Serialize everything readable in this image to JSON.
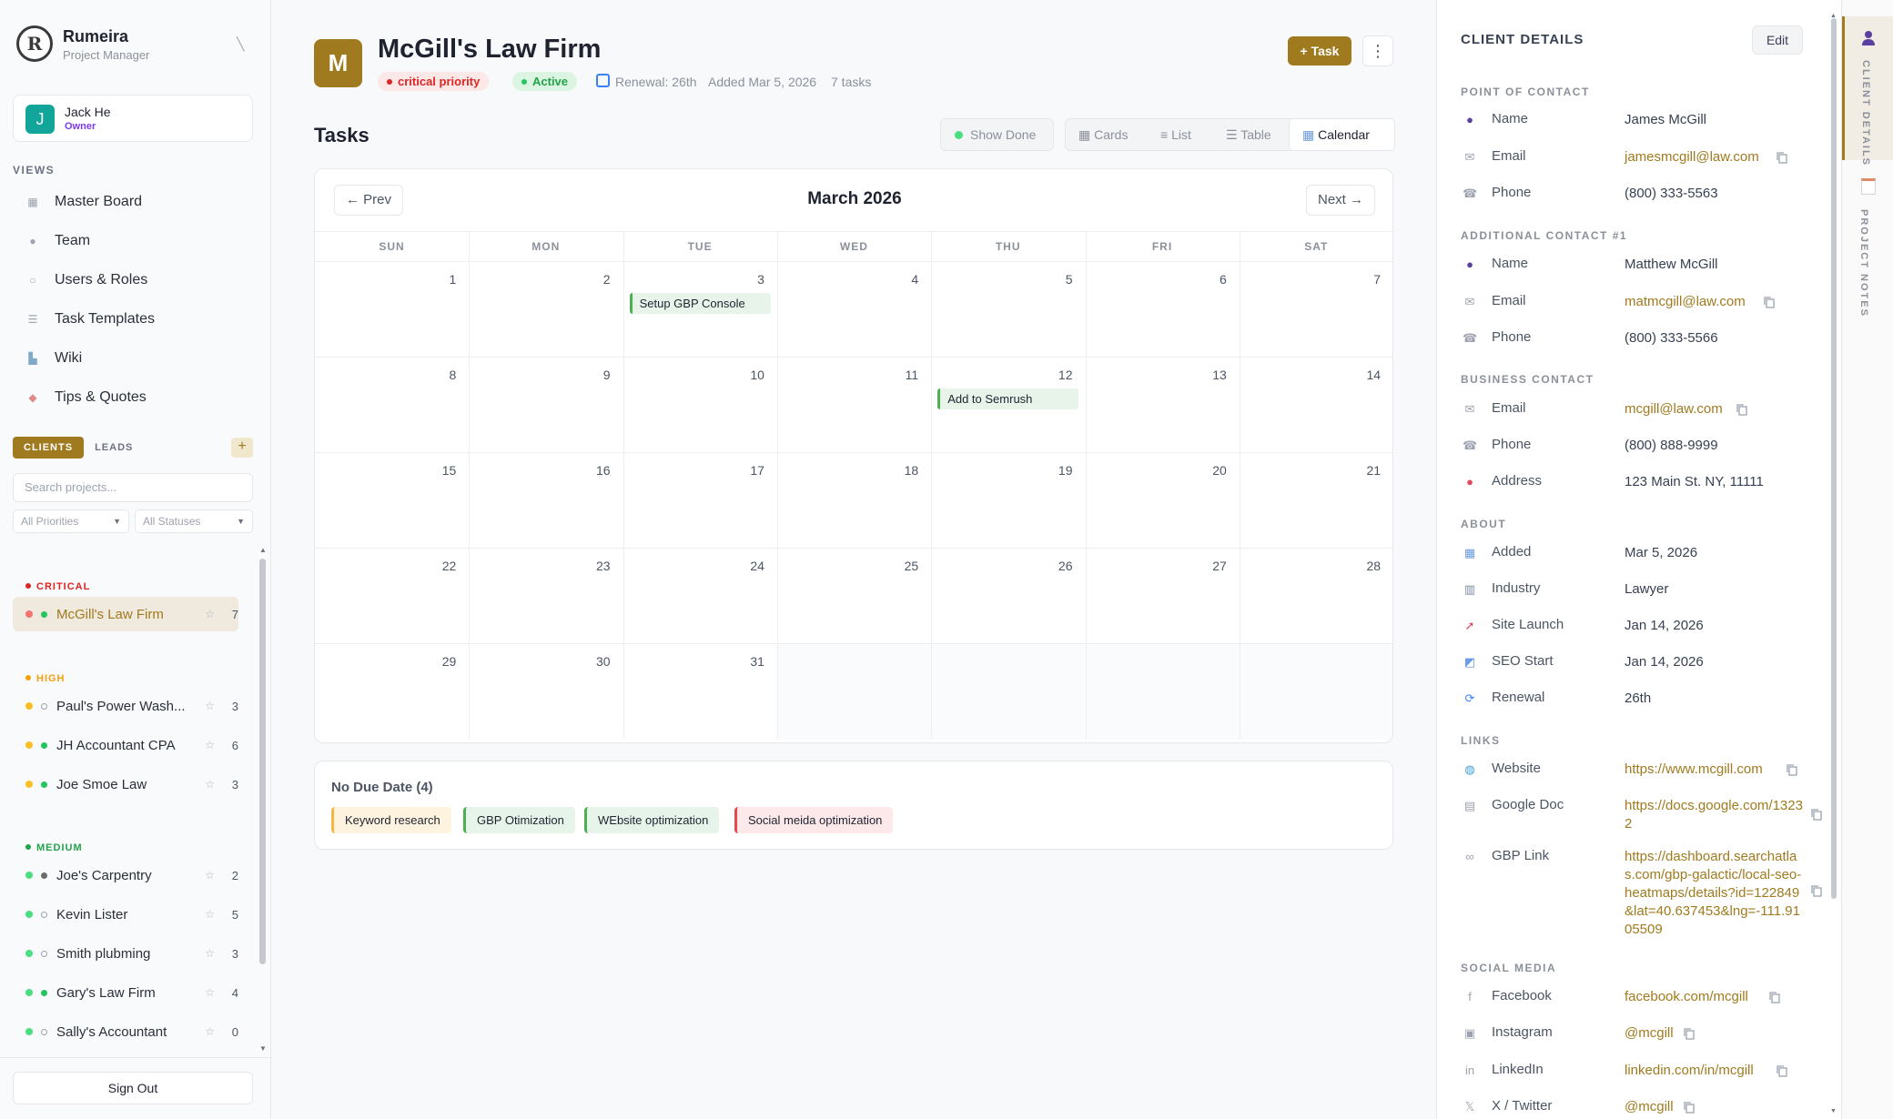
{
  "app": {
    "name": "Rumeira",
    "subtitle": "Project Manager"
  },
  "user": {
    "initial": "J",
    "name": "Jack He",
    "role": "Owner"
  },
  "views": {
    "heading": "VIEWS",
    "items": [
      {
        "label": "Master Board",
        "icon": "board-icon"
      },
      {
        "label": "Team",
        "icon": "team-icon"
      },
      {
        "label": "Users & Roles",
        "icon": "users-icon"
      },
      {
        "label": "Task Templates",
        "icon": "templates-icon"
      },
      {
        "label": "Wiki",
        "icon": "wiki-icon"
      },
      {
        "label": "Tips & Quotes",
        "icon": "tips-icon"
      }
    ]
  },
  "list_tabs": {
    "clients": "CLIENTS",
    "leads": "LEADS",
    "add": "+"
  },
  "search": {
    "placeholder": "Search projects..."
  },
  "filters": {
    "priority": "All Priorities",
    "status": "All Statuses"
  },
  "groups": {
    "critical": {
      "label": "CRITICAL",
      "color": "#dc2626"
    },
    "high": {
      "label": "HIGH",
      "color": "#f59e0b"
    },
    "medium": {
      "label": "MEDIUM",
      "color": "#22a34a"
    }
  },
  "projects": [
    {
      "name": "McGill's Law Firm",
      "count": "7",
      "priority_color": "#f87171",
      "status": "active"
    },
    {
      "name": "Paul's Power Wash...",
      "count": "3",
      "priority_color": "#fbbf24",
      "status": "inactive"
    },
    {
      "name": "JH Accountant CPA",
      "count": "6",
      "priority_color": "#fbbf24",
      "status": "active"
    },
    {
      "name": "Joe Smoe Law",
      "count": "3",
      "priority_color": "#fbbf24",
      "status": "active"
    },
    {
      "name": "Joe's Carpentry",
      "count": "2",
      "priority_color": "#4ade80",
      "status": "dark"
    },
    {
      "name": "Kevin Lister",
      "count": "5",
      "priority_color": "#4ade80",
      "status": "inactive"
    },
    {
      "name": "Smith plubming",
      "count": "3",
      "priority_color": "#4ade80",
      "status": "inactive"
    },
    {
      "name": "Gary's Law Firm",
      "count": "4",
      "priority_color": "#4ade80",
      "status": "active"
    },
    {
      "name": "Sally's Accountant",
      "count": "0",
      "priority_color": "#4ade80",
      "status": "inactive"
    }
  ],
  "sign_out": "Sign Out",
  "project": {
    "initial": "M",
    "title": "McGill's Law Firm",
    "priority_badge": "critical priority",
    "status_badge": "Active",
    "renewal": "Renewal: 26th",
    "added": "Added Mar 5, 2026",
    "task_count": "7 tasks",
    "add_task": "+ Task",
    "more": "⋮"
  },
  "tasks": {
    "heading": "Tasks",
    "show_done": "Show Done",
    "views": [
      "Cards",
      "List",
      "Table",
      "Calendar"
    ],
    "active_view": "Calendar"
  },
  "calendar": {
    "prev": "← Prev",
    "next": "Next →",
    "month": "March 2026",
    "weekdays": [
      "SUN",
      "MON",
      "TUE",
      "WED",
      "THU",
      "FRI",
      "SAT"
    ],
    "days": [
      "1",
      "2",
      "3",
      "4",
      "5",
      "6",
      "7",
      "8",
      "9",
      "10",
      "11",
      "12",
      "13",
      "14",
      "15",
      "16",
      "17",
      "18",
      "19",
      "20",
      "21",
      "22",
      "23",
      "24",
      "25",
      "26",
      "27",
      "28",
      "29",
      "30",
      "31"
    ],
    "events": [
      {
        "day": "3",
        "title": "Setup GBP Console"
      },
      {
        "day": "12",
        "title": "Add to Semrush"
      }
    ]
  },
  "no_due": {
    "heading": "No Due Date (4)",
    "chips": [
      {
        "label": "Keyword research",
        "bg": "#fdf3df",
        "border": "#f4b740"
      },
      {
        "label": "GBP Otimization",
        "bg": "#e6f4ea",
        "border": "#4caf50"
      },
      {
        "label": "WEbsite optimization",
        "bg": "#e6f4ea",
        "border": "#4caf50"
      },
      {
        "label": "Social meida optimization",
        "bg": "#fde8ea",
        "border": "#e5484d"
      }
    ]
  },
  "client_details": {
    "heading": "CLIENT DETAILS",
    "edit": "Edit",
    "point_of_contact": {
      "heading": "POINT OF CONTACT",
      "name_label": "Name",
      "name": "James McGill",
      "email_label": "Email",
      "email": "jamesmcgill@law.com",
      "phone_label": "Phone",
      "phone": "(800) 333-5563"
    },
    "additional_contact": {
      "heading": "ADDITIONAL CONTACT #1",
      "name_label": "Name",
      "name": "Matthew McGill",
      "email_label": "Email",
      "email": "matmcgill@law.com",
      "phone_label": "Phone",
      "phone": "(800) 333-5566"
    },
    "business_contact": {
      "heading": "BUSINESS CONTACT",
      "email_label": "Email",
      "email": "mcgill@law.com",
      "phone_label": "Phone",
      "phone": "(800) 888-9999",
      "address_label": "Address",
      "address": "123 Main St. NY, 11111"
    },
    "about": {
      "heading": "ABOUT",
      "added_label": "Added",
      "added": "Mar 5, 2026",
      "industry_label": "Industry",
      "industry": "Lawyer",
      "site_launch_label": "Site Launch",
      "site_launch": "Jan 14, 2026",
      "seo_start_label": "SEO Start",
      "seo_start": "Jan 14, 2026",
      "renewal_label": "Renewal",
      "renewal": "26th"
    },
    "links": {
      "heading": "LINKS",
      "website_label": "Website",
      "website": "https://www.mcgill.com",
      "google_doc_label": "Google Doc",
      "google_doc": "https://docs.google.com/13232",
      "gbp_label": "GBP Link",
      "gbp": "https://dashboard.searchatlas.com/gbp-galactic/local-seo-heatmaps/details?id=122849&lat=40.637453&lng=-111.9105509"
    },
    "social": {
      "heading": "SOCIAL MEDIA",
      "facebook_label": "Facebook",
      "facebook": "facebook.com/mcgill",
      "instagram_label": "Instagram",
      "instagram": "@mcgill",
      "linkedin_label": "LinkedIn",
      "linkedin": "linkedin.com/in/mcgill",
      "twitter_label": "X / Twitter",
      "twitter": "@mcgill"
    }
  },
  "side_tabs": {
    "client_details": "CLIENT DETAILS",
    "project_notes": "PROJECT NOTES"
  },
  "colors": {
    "accent": "#a07a1e",
    "critical": "#dc2626",
    "active": "#22c55e"
  }
}
